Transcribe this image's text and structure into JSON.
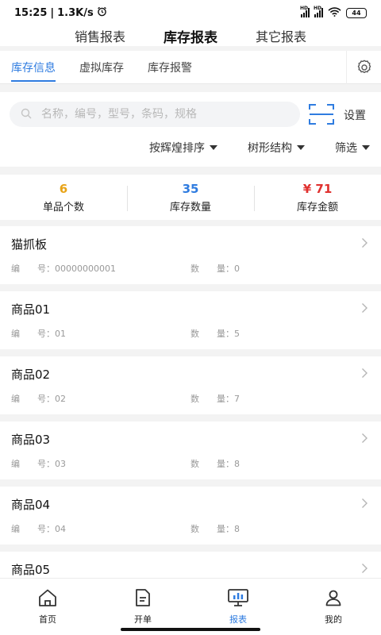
{
  "status_bar": {
    "time": "15:25",
    "speed": "1.3K/s",
    "battery": "44",
    "signal_label": "HD"
  },
  "top_tabs": [
    "销售报表",
    "库存报表",
    "其它报表"
  ],
  "sub_tabs": [
    "库存信息",
    "虚拟库存",
    "库存报警"
  ],
  "search": {
    "placeholder": "名称，编号，型号，条码，规格",
    "settings_label": "设置"
  },
  "filters": {
    "sort_label": "按辉煌排序",
    "tree_label": "树形结构",
    "filter_label": "筛选"
  },
  "summary": [
    {
      "value": "6",
      "label": "单品个数",
      "color": "#e8a317"
    },
    {
      "value": "35",
      "label": "库存数量",
      "color": "#2f7ce0"
    },
    {
      "value": "¥ 71",
      "label": "库存金额",
      "color": "#e0312f"
    }
  ],
  "items": [
    {
      "name": "猫抓板",
      "code": "编　　号：00000000001",
      "qty": "数　　量：0"
    },
    {
      "name": "商品01",
      "code": "编　　号：01",
      "qty": "数　　量：5"
    },
    {
      "name": "商品02",
      "code": "编　　号：02",
      "qty": "数　　量：7"
    },
    {
      "name": "商品03",
      "code": "编　　号：03",
      "qty": "数　　量：8"
    },
    {
      "name": "商品04",
      "code": "编　　号：04",
      "qty": "数　　量：8"
    },
    {
      "name": "商品05",
      "code": "",
      "qty": ""
    }
  ],
  "bottom_nav": [
    {
      "label": "首页",
      "icon": "home-icon"
    },
    {
      "label": "开单",
      "icon": "document-icon"
    },
    {
      "label": "报表",
      "icon": "report-icon"
    },
    {
      "label": "我的",
      "icon": "user-icon"
    }
  ],
  "colors": {
    "accent": "#2f7ce0"
  }
}
